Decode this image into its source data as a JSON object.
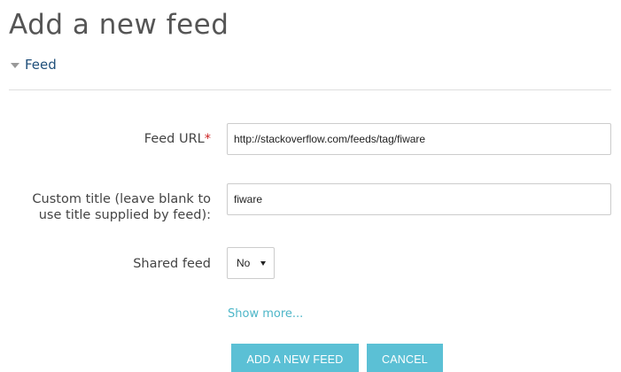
{
  "page": {
    "title": "Add a new feed"
  },
  "section": {
    "label": "Feed",
    "icon": "caret-down-icon"
  },
  "form": {
    "feed_url": {
      "label": "Feed URL",
      "required_marker": "*",
      "value": "http://stackoverflow.com/feeds/tag/fiware"
    },
    "custom_title": {
      "label_line1": "Custom title (leave blank to",
      "label_line2": "use title supplied by feed):",
      "value": "fiware"
    },
    "shared_feed": {
      "label": "Shared feed",
      "selected": "No",
      "icon": "dropdown-arrow-icon"
    },
    "show_more": "Show more..."
  },
  "buttons": {
    "submit": "ADD A NEW FEED",
    "cancel": "CANCEL"
  },
  "colors": {
    "accent_button": "#5bc0d5",
    "link": "#4db6c8",
    "section_label": "#1f4f7a",
    "required": "#cc2222"
  }
}
